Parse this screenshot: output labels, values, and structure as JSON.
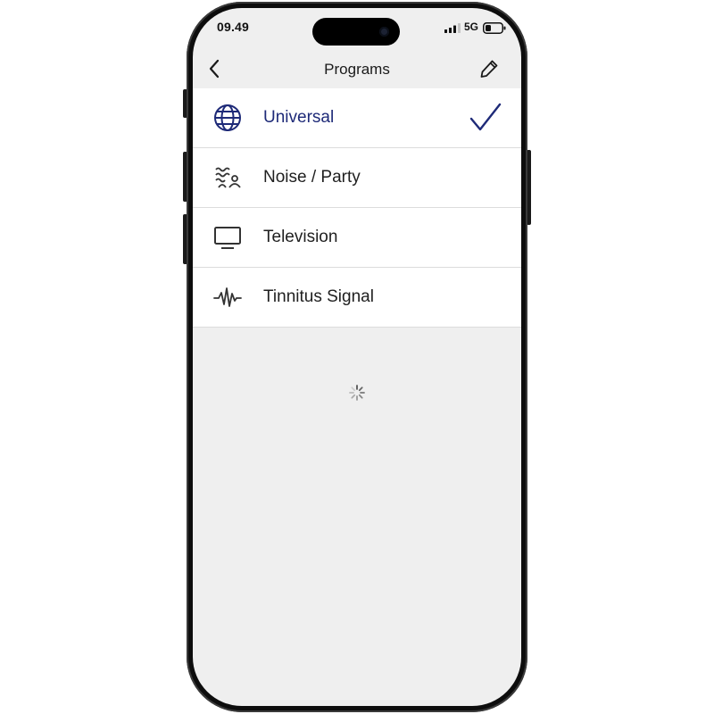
{
  "status_bar": {
    "time": "09.49",
    "network": "5G",
    "icons": [
      "signal-icon",
      "battery-icon",
      "camera-icon"
    ]
  },
  "nav": {
    "title": "Programs",
    "back_icon": "chevron-left-icon",
    "edit_icon": "pencil-icon"
  },
  "programs": [
    {
      "label": "Universal",
      "icon": "globe-icon",
      "selected": true
    },
    {
      "label": "Noise / Party",
      "icon": "noise-party-icon",
      "selected": false
    },
    {
      "label": "Television",
      "icon": "television-icon",
      "selected": false
    },
    {
      "label": "Tinnitus Signal",
      "icon": "tinnitus-wave-icon",
      "selected": false
    }
  ],
  "colors": {
    "selected_accent": "#1e2a78",
    "text": "#1f1f1f",
    "icon": "#333333",
    "list_background": "#ffffff",
    "screen_background": "#efefef",
    "divider": "#dcdcdc"
  },
  "loading": {
    "icon": "spinner-icon",
    "visible": true
  }
}
